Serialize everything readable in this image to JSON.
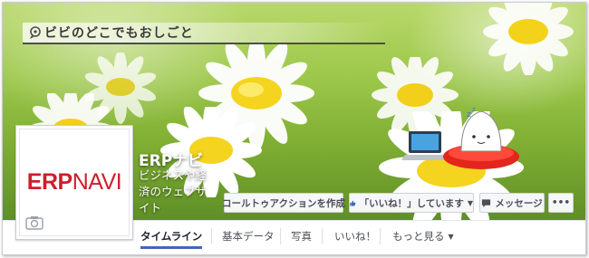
{
  "cover": {
    "banner_text": "ビビのどこでもおしごと",
    "banner_icon": "location-pin-icon"
  },
  "profile": {
    "logo_part1": "ERP",
    "logo_part2": "NAVI",
    "page_name": "ERPナビ",
    "description_line1": "ビジネスや経",
    "description_line2": "済のウェブサ",
    "description_line3": "イト",
    "camera_icon": "camera-icon"
  },
  "actions": {
    "call_to_action": "コールトゥアクションを作成",
    "liked_label": "「いいね！」しています",
    "message_label": "メッセージ",
    "more_label": "•••"
  },
  "tabs": [
    {
      "label": "タイムライン",
      "active": true
    },
    {
      "label": "基本データ",
      "active": false
    },
    {
      "label": "写真",
      "active": false
    },
    {
      "label": "いいね！",
      "active": false
    },
    {
      "label": "もっと見る",
      "active": false
    }
  ],
  "colors": {
    "accent_blue": "#4267b2",
    "logo_red": "#cc1f2b"
  }
}
